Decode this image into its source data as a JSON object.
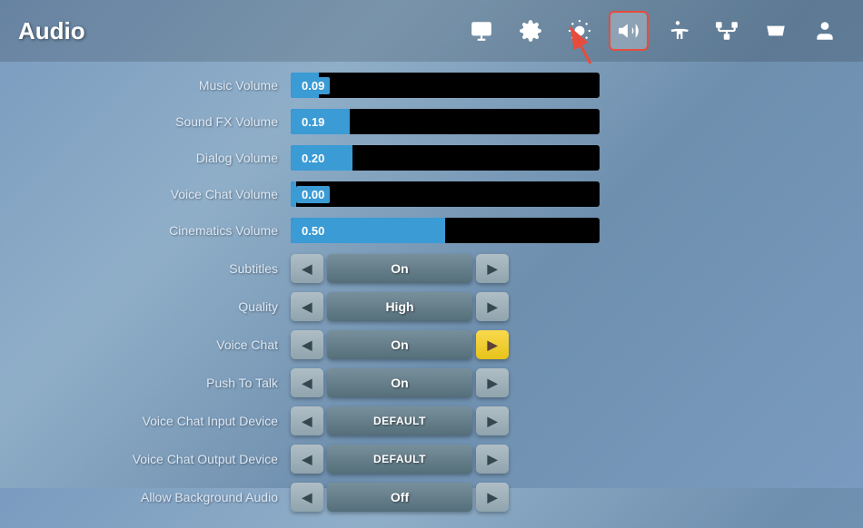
{
  "header": {
    "title": "Audio",
    "nav": [
      {
        "id": "display",
        "icon": "monitor",
        "active": false
      },
      {
        "id": "settings",
        "icon": "gear",
        "active": false
      },
      {
        "id": "brightness",
        "icon": "sun",
        "active": false
      },
      {
        "id": "audio",
        "icon": "speaker",
        "active": true
      },
      {
        "id": "accessibility",
        "icon": "person-circle",
        "active": false
      },
      {
        "id": "network",
        "icon": "network",
        "active": false
      },
      {
        "id": "gamepad",
        "icon": "gamepad",
        "active": false
      },
      {
        "id": "account",
        "icon": "account",
        "active": false
      }
    ]
  },
  "sliders": [
    {
      "label": "Music Volume",
      "value": "0.09",
      "fill_pct": 9
    },
    {
      "label": "Sound FX Volume",
      "value": "0.19",
      "fill_pct": 19
    },
    {
      "label": "Dialog Volume",
      "value": "0.20",
      "fill_pct": 20
    },
    {
      "label": "Voice Chat Volume",
      "value": "0.00",
      "fill_pct": 0
    },
    {
      "label": "Cinematics Volume",
      "value": "0.50",
      "fill_pct": 50
    }
  ],
  "toggles": [
    {
      "label": "Subtitles",
      "value": "On",
      "right_yellow": false
    },
    {
      "label": "Quality",
      "value": "High",
      "right_yellow": false
    },
    {
      "label": "Voice Chat",
      "value": "On",
      "right_yellow": true
    },
    {
      "label": "Push To Talk",
      "value": "On",
      "right_yellow": false
    },
    {
      "label": "Voice Chat Input Device",
      "value": "DEFAULT",
      "right_yellow": false
    },
    {
      "label": "Voice Chat Output Device",
      "value": "DEFAULT",
      "right_yellow": false
    },
    {
      "label": "Allow Background Audio",
      "value": "Off",
      "right_yellow": false
    }
  ],
  "buttons": {
    "left_arrow": "◀",
    "right_arrow": "▶"
  }
}
